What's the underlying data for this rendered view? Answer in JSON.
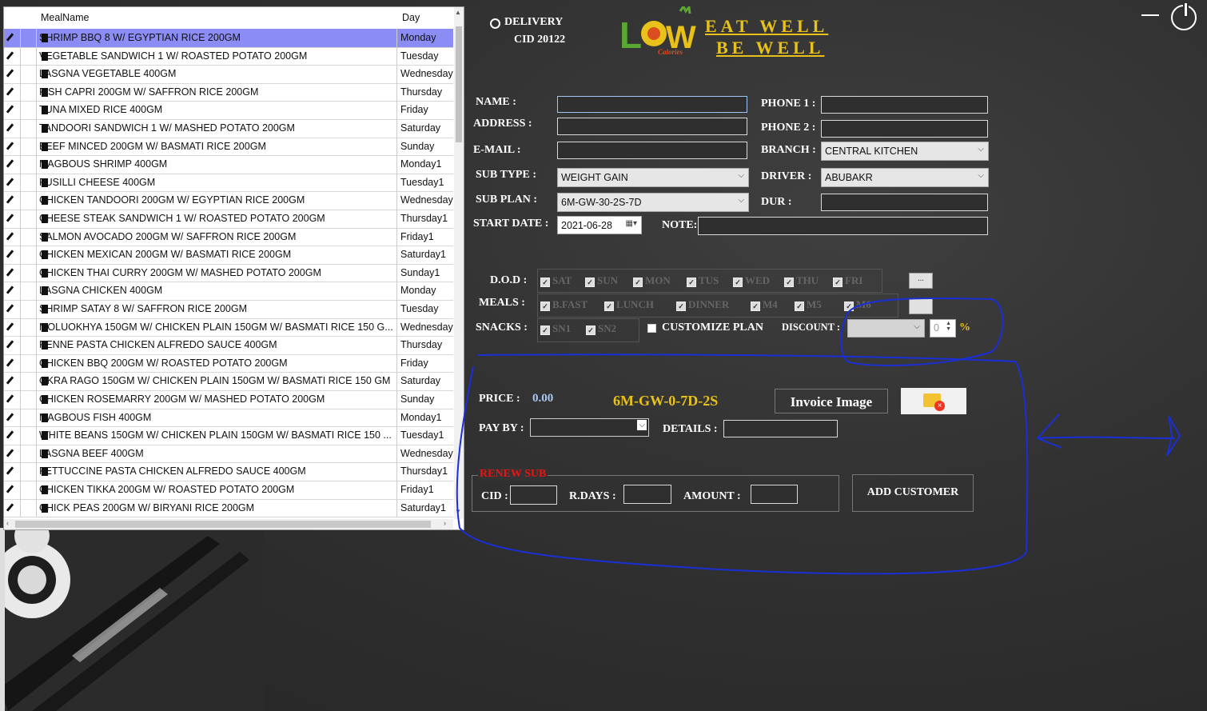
{
  "grid": {
    "headers": {
      "meal": "MealName",
      "day": "Day"
    },
    "rows": [
      {
        "meal": "SHRIMP BBQ 8 W/ EGYPTIAN RICE 200GM",
        "day": "Monday"
      },
      {
        "meal": "VEGETABLE SANDWICH 1 W/ ROASTED POTATO 200GM",
        "day": "Tuesday"
      },
      {
        "meal": "LASGNA VEGETABLE 400GM",
        "day": "Wednesday"
      },
      {
        "meal": "FISH CAPRI 200GM W/ SAFFRON RICE 200GM",
        "day": "Thursday"
      },
      {
        "meal": "TUNA MIXED RICE 400GM",
        "day": "Friday"
      },
      {
        "meal": "TANDOORI SANDWICH 1 W/ MASHED POTATO 200GM",
        "day": "Saturday"
      },
      {
        "meal": "BEEF MINCED 200GM W/ BASMATI RICE 200GM",
        "day": "Sunday"
      },
      {
        "meal": "MAGBOUS SHRIMP 400GM",
        "day": "Monday1"
      },
      {
        "meal": "FUSILLI CHEESE 400GM",
        "day": "Tuesday1"
      },
      {
        "meal": "CHICKEN TANDOORI 200GM W/ EGYPTIAN RICE 200GM",
        "day": "Wednesday"
      },
      {
        "meal": "CHEESE STEAK SANDWICH 1 W/ ROASTED POTATO 200GM",
        "day": "Thursday1"
      },
      {
        "meal": "SALMON AVOCADO 200GM W/ SAFFRON RICE 200GM",
        "day": "Friday1"
      },
      {
        "meal": "CHICKEN MEXICAN 200GM W/ BASMATI RICE 200GM",
        "day": "Saturday1"
      },
      {
        "meal": "CHICKEN THAI CURRY 200GM W/ MASHED POTATO 200GM",
        "day": "Sunday1"
      },
      {
        "meal": "LASGNA CHICKEN 400GM",
        "day": "Monday"
      },
      {
        "meal": "SHRIMP SATAY 8 W/ SAFFRON RICE 200GM",
        "day": "Tuesday"
      },
      {
        "meal": "MOLUOKHYA 150GM W/ CHICKEN PLAIN 150GM W/ BASMATI RICE 150 G...",
        "day": "Wednesday"
      },
      {
        "meal": "PENNE PASTA CHICKEN ALFREDO SAUCE 400GM",
        "day": "Thursday"
      },
      {
        "meal": "CHICKEN BBQ 200GM W/ ROASTED POTATO 200GM",
        "day": "Friday"
      },
      {
        "meal": "OKRA RAGO 150GM W/ CHICKEN PLAIN 150GM W/ BASMATI RICE 150 GM",
        "day": "Saturday"
      },
      {
        "meal": "CHICKEN ROSEMARRY 200GM W/ MASHED POTATO 200GM",
        "day": "Sunday"
      },
      {
        "meal": "MAGBOUS FISH 400GM",
        "day": "Monday1"
      },
      {
        "meal": "WHITE BEANS 150GM W/ CHICKEN PLAIN 150GM W/ BASMATI RICE 150 ...",
        "day": "Tuesday1"
      },
      {
        "meal": "LASGNA BEEF 400GM",
        "day": "Wednesday"
      },
      {
        "meal": "FETTUCCINE PASTA CHICKEN ALFREDO SAUCE 400GM",
        "day": "Thursday1"
      },
      {
        "meal": "CHICKEN TIKKA 200GM W/ ROASTED POTATO 200GM",
        "day": "Friday1"
      },
      {
        "meal": "CHICK PEAS 200GM W/ BIRYANI RICE 200GM",
        "day": "Saturday1"
      }
    ]
  },
  "header": {
    "delivery": "DELIVERY",
    "cid": "CID 20122",
    "logo_sub": "Calories",
    "slogan1": "EAT WELL",
    "slogan2": "BE WELL"
  },
  "form": {
    "name": "NAME :",
    "address": "ADDRESS :",
    "email": "E-MAIL :",
    "sub_type": "SUB TYPE :",
    "sub_type_value": "WEIGHT GAIN",
    "sub_plan": "SUB PLAN :",
    "sub_plan_value": "6M-GW-30-2S-7D",
    "start_date": "START DATE :",
    "start_date_value": "2021-06-28",
    "phone1": "PHONE 1 :",
    "phone2": "PHONE 2 :",
    "branch": "BRANCH :",
    "branch_value": "CENTRAL KITCHEN",
    "driver": "DRIVER :",
    "driver_value": "ABUBAKR",
    "dur": "DUR :",
    "note": "NOTE:"
  },
  "options": {
    "dod": "D.O.D :",
    "days": [
      "SAT",
      "SUN",
      "MON",
      "TUS",
      "WED",
      "THU",
      "FRI"
    ],
    "meals": "MEALS :",
    "meal_items": [
      "B.FAST",
      "LUNCH",
      "DINNER",
      "M4",
      "M5",
      "M6"
    ],
    "snacks": "SNACKS :",
    "snack_items": [
      "SN1",
      "SN2"
    ],
    "customize": "CUSTOMIZE PLAN",
    "discount": "DISCOUNT :",
    "discount_value": "0",
    "percent": "%",
    "more": "..."
  },
  "pricing": {
    "price_label": "PRICE :",
    "price": "0.00",
    "plan_code": "6M-GW-0-7D-2S",
    "invoice": "Invoice Image",
    "pay_by": "PAY BY :",
    "details": "DETAILS :"
  },
  "renew": {
    "title": "RENEW SUB",
    "cid": "CID :",
    "rdays": "R.DAYS :",
    "amount": "AMOUNT :"
  },
  "actions": {
    "add_customer": "ADD CUSTOMER"
  },
  "colors": {
    "accent_green": "#5aa832",
    "accent_yellow": "#e8c21a",
    "selected_row": "#8c8cf5",
    "renew_red": "#e11",
    "annotation_blue": "#1a2fd6"
  }
}
